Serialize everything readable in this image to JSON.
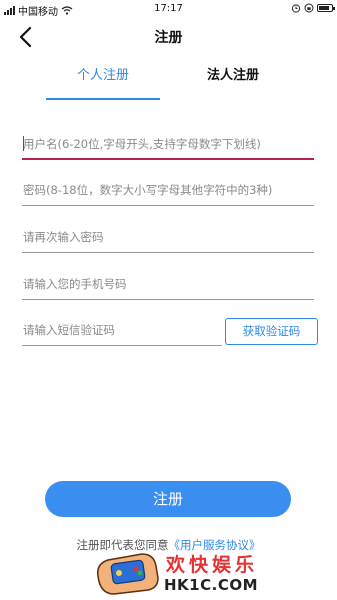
{
  "status_bar": {
    "carrier": "中国移动",
    "time": "17:17"
  },
  "header": {
    "title": "注册"
  },
  "tabs": [
    {
      "label": "个人注册",
      "active": true
    },
    {
      "label": "法人注册",
      "active": false
    }
  ],
  "form": {
    "username_placeholder": "用户名(6-20位,字母开头,支持字母数字下划线)",
    "password_placeholder": "密码(8-18位，数字大小写字母其他字符中的3种)",
    "confirm_password_placeholder": "请再次输入密码",
    "phone_placeholder": "请输入您的手机号码",
    "sms_code_placeholder": "请输入短信验证码",
    "get_code_label": "获取验证码"
  },
  "submit_label": "注册",
  "agreement": {
    "prefix": "注册即代表您同意",
    "link": "《用户服务协议》"
  },
  "watermark": {
    "title": "欢快娱乐",
    "site": "HK1C.COM"
  },
  "colors": {
    "accent": "#2f89e9",
    "button": "#3a8ef0",
    "focus": "#b0244d"
  }
}
